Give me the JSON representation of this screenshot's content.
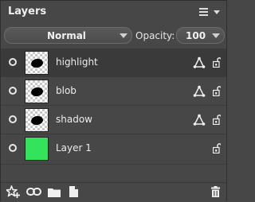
{
  "panel": {
    "title": "Layers",
    "icons": [
      "menu-icon",
      "dropdown-arrow-icon"
    ]
  },
  "controls": {
    "blend_mode": "Normal",
    "opacity_label": "Opacity:",
    "opacity_value": "100"
  },
  "layers": [
    {
      "name": "highlight",
      "selected": true,
      "thumbnail": "blob",
      "has_vector": true,
      "lock": "unlocked"
    },
    {
      "name": "blob",
      "selected": false,
      "thumbnail": "blob",
      "has_vector": true,
      "lock": "unlocked"
    },
    {
      "name": "shadow",
      "selected": false,
      "thumbnail": "blob",
      "has_vector": true,
      "lock": "unlocked"
    },
    {
      "name": "Layer 1",
      "selected": false,
      "thumbnail": "solid-green",
      "has_vector": false,
      "lock": "unlocked"
    }
  ],
  "footer": {
    "icons": [
      "new-adjustment-star-icon",
      "link-icon",
      "folder-icon",
      "new-layer-icon",
      "delete-icon"
    ]
  },
  "colors": {
    "panel_bg": "#474747",
    "selected_row_bg": "#3a3a3a",
    "layer1_fill": "#34e35c"
  }
}
